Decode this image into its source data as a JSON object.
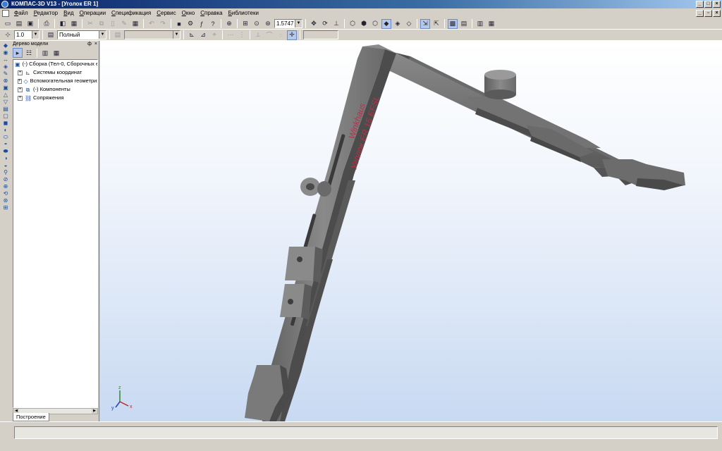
{
  "window": {
    "title": "КОМПАС-3D V13 - [Уголок ER 1]"
  },
  "menu": {
    "items": [
      "Файл",
      "Редактор",
      "Вид",
      "Операции",
      "Спецификация",
      "Сервис",
      "Окно",
      "Справка",
      "Библиотеки"
    ]
  },
  "toolbar": {
    "zoom_value": "1.5747",
    "step_value": "1.0",
    "display_mode": "Полный",
    "layer_value": ""
  },
  "tree": {
    "header": "Дерево модели",
    "pin": "ф",
    "close": "×",
    "items": [
      {
        "label": "(-) Сборка (Тел-0, Сборочных е"
      },
      {
        "label": "Системы координат"
      },
      {
        "label": "Вспомогательная геометрия"
      },
      {
        "label": "(-) Компоненты"
      },
      {
        "label": "Сопряжения"
      }
    ],
    "tab": "Построение"
  },
  "model": {
    "engraving_line1": "Winkhaus",
    "engraving_line2": "Уголок ER 15 EFSL"
  },
  "triad": {
    "x": "x",
    "y": "y",
    "z": "z"
  },
  "status": {
    "text": ""
  },
  "colors": {
    "title_start": "#0a246a",
    "title_end": "#a6caf0",
    "viewport_bottom": "#c8d9f2",
    "metal": "#7b7b7b",
    "engraving": "#b8324a"
  }
}
